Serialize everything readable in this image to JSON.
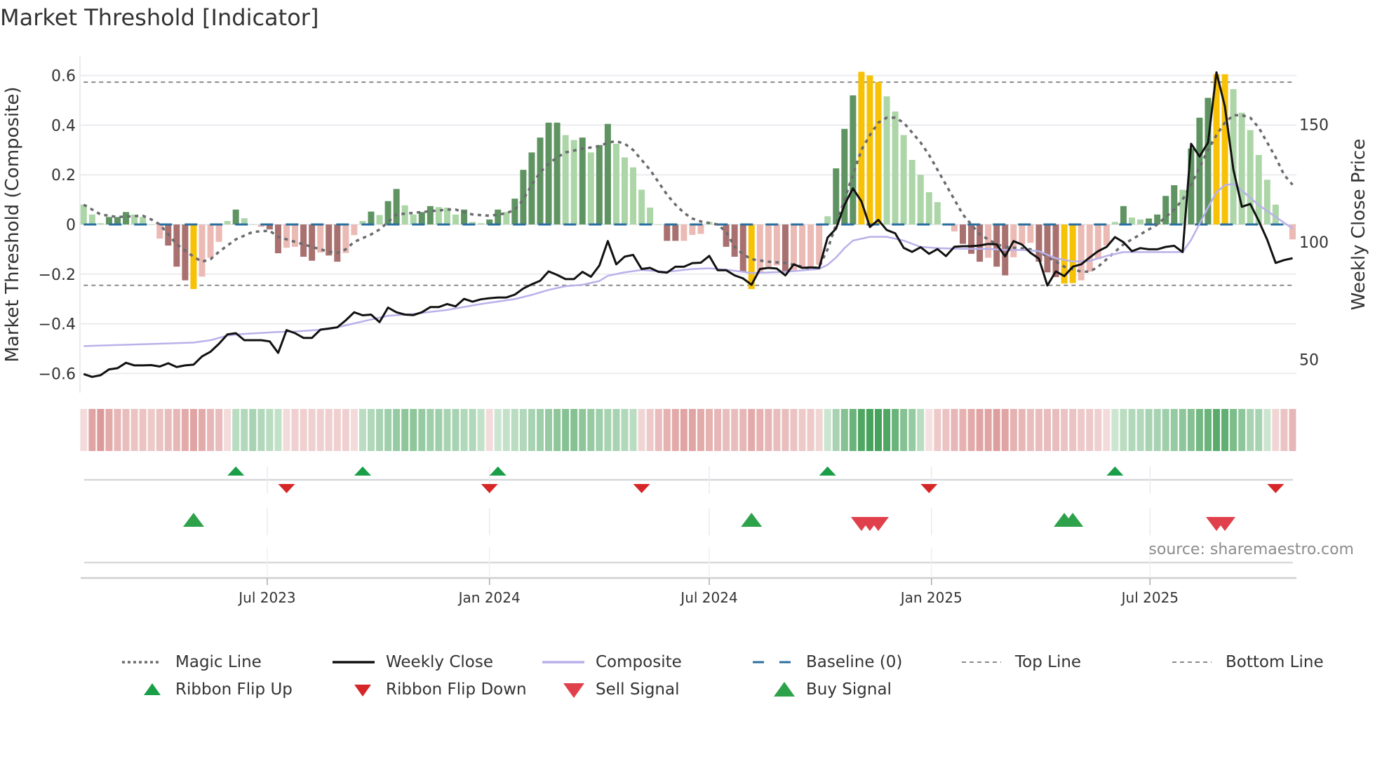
{
  "title": "Market Threshold [Indicator]",
  "source": "source: sharemaestro.com",
  "legend": [
    {
      "label": "Magic Line",
      "icon": "dotted-line"
    },
    {
      "label": "Weekly Close",
      "icon": "solid-line"
    },
    {
      "label": "Composite",
      "icon": "solid-line"
    },
    {
      "label": "Baseline (0)",
      "icon": "dashed-line"
    },
    {
      "label": "Top Line",
      "icon": "dashed-line"
    },
    {
      "label": "Bottom Line",
      "icon": "dashed-line"
    },
    {
      "label": "Ribbon Flip Up",
      "icon": "triangle-up"
    },
    {
      "label": "Ribbon Flip Down",
      "icon": "triangle-down"
    },
    {
      "label": "Sell Signal",
      "icon": "triangle-down"
    },
    {
      "label": "Buy Signal",
      "icon": "triangle-up"
    }
  ],
  "colors": {
    "dg": "#5f9462",
    "lg": "#acd6a7",
    "dr": "#a8716f",
    "lr": "#ebbab5",
    "y": "#f7c106",
    "magic": "#6b6b70",
    "close": "#111111",
    "composite": "#b9b1ea",
    "baseline": "#2a6f9f",
    "threshold": "#8a8a8a",
    "ribbon_pos": "#2f9646",
    "ribbon_neg": "#cf6f6f",
    "flip_up": "#1a9e48",
    "flip_down": "#d62728",
    "buy": "#2ea24a",
    "sell": "#e0404c"
  },
  "chart_data": {
    "type": "bar+line",
    "title": "Market Threshold [Indicator]",
    "ylabel": "Market Threshold (Composite)",
    "y2label": "Weekly Close Price",
    "start_date": "2023-01-30",
    "interval_days": 7,
    "ylim": [
      -0.68,
      0.68
    ],
    "y_ticks": [
      0.6,
      0.4,
      0.2,
      0,
      -0.2,
      -0.4,
      -0.6
    ],
    "y_tick_labels": [
      "0.6",
      "0.4",
      "0.2",
      "0",
      "−0.2",
      "−0.4",
      "−0.6"
    ],
    "y2_ticks": [
      150,
      100,
      50
    ],
    "y2_tick_labels": [
      "150",
      "100",
      "50"
    ],
    "x_ticks": [
      "2023-07-01",
      "2024-01-01",
      "2024-07-01",
      "2025-01-01",
      "2025-07-01"
    ],
    "x_tick_labels": [
      "Jul 2023",
      "Jan 2024",
      "Jul 2024",
      "Jan 2025",
      "Jul 2025"
    ],
    "top_line": 0.573,
    "bottom_line": -0.245,
    "baseline": 0,
    "histogram": [
      0.08,
      0.04,
      0.005,
      0.03,
      0.03,
      0.05,
      0.04,
      0.03,
      0.0,
      -0.057,
      -0.085,
      -0.17,
      -0.225,
      -0.26,
      -0.21,
      -0.134,
      -0.07,
      0.014,
      0.06,
      0.025,
      0.0,
      -0.01,
      -0.02,
      -0.116,
      -0.094,
      -0.09,
      -0.13,
      -0.146,
      -0.113,
      -0.125,
      -0.15,
      -0.115,
      -0.043,
      0.014,
      0.052,
      0.038,
      0.094,
      0.143,
      0.077,
      0.04,
      0.05,
      0.074,
      0.07,
      0.068,
      0.04,
      0.06,
      0.01,
      0.005,
      0.02,
      0.06,
      0.05,
      0.104,
      0.22,
      0.29,
      0.35,
      0.41,
      0.41,
      0.36,
      0.34,
      0.35,
      0.29,
      0.32,
      0.405,
      0.325,
      0.27,
      0.23,
      0.14,
      0.068,
      0.0,
      -0.066,
      -0.066,
      -0.066,
      -0.042,
      -0.038,
      0.01,
      -0.005,
      -0.09,
      -0.13,
      -0.19,
      -0.26,
      -0.19,
      -0.17,
      -0.165,
      -0.19,
      -0.184,
      -0.177,
      -0.173,
      -0.162,
      0.033,
      0.226,
      0.385,
      0.52,
      0.615,
      0.6,
      0.574,
      0.516,
      0.455,
      0.36,
      0.26,
      0.2,
      0.13,
      0.09,
      0.003,
      -0.028,
      -0.078,
      -0.118,
      -0.15,
      -0.134,
      -0.17,
      -0.205,
      -0.132,
      -0.08,
      -0.074,
      -0.15,
      -0.193,
      -0.212,
      -0.238,
      -0.236,
      -0.225,
      -0.19,
      -0.14,
      -0.085,
      0.01,
      0.074,
      0.028,
      0.02,
      0.024,
      0.04,
      0.115,
      0.158,
      0.14,
      0.306,
      0.43,
      0.51,
      0.605,
      0.605,
      0.545,
      0.45,
      0.38,
      0.28,
      0.18,
      0.08,
      0.0,
      -0.06
    ],
    "histogram_class": [
      "lg",
      "lg",
      "lg",
      "dg",
      "dg",
      "dg",
      "lg",
      "lg",
      "lg",
      "lr",
      "dr",
      "dr",
      "dr",
      "y",
      "lr",
      "lr",
      "lr",
      "lg",
      "dg",
      "lg",
      "lg",
      "lr",
      "dr",
      "dr",
      "lr",
      "lr",
      "dr",
      "dr",
      "lr",
      "dr",
      "dr",
      "lr",
      "lr",
      "lg",
      "dg",
      "lg",
      "dg",
      "dg",
      "lg",
      "lg",
      "dg",
      "dg",
      "lg",
      "lg",
      "lg",
      "dg",
      "lg",
      "lg",
      "dg",
      "dg",
      "lg",
      "dg",
      "dg",
      "dg",
      "dg",
      "dg",
      "dg",
      "lg",
      "lg",
      "dg",
      "lg",
      "dg",
      "dg",
      "lg",
      "lg",
      "lg",
      "lg",
      "lg",
      "lg",
      "dr",
      "dr",
      "lr",
      "lr",
      "lr",
      "lg",
      "lr",
      "dr",
      "dr",
      "dr",
      "y",
      "lr",
      "lr",
      "lr",
      "dr",
      "lr",
      "lr",
      "lr",
      "lr",
      "lg",
      "dg",
      "dg",
      "dg",
      "y",
      "y",
      "y",
      "lg",
      "lg",
      "lg",
      "lg",
      "lg",
      "lg",
      "lg",
      "lg",
      "lr",
      "dr",
      "dr",
      "dr",
      "lr",
      "dr",
      "dr",
      "lr",
      "lr",
      "lr",
      "dr",
      "dr",
      "dr",
      "y",
      "y",
      "lr",
      "lr",
      "lr",
      "lr",
      "lg",
      "dg",
      "lg",
      "lg",
      "dg",
      "dg",
      "dg",
      "dg",
      "lg",
      "dg",
      "dg",
      "dg",
      "y",
      "y",
      "lg",
      "lg",
      "lg",
      "lg",
      "lg",
      "lg",
      "lg",
      "lr"
    ],
    "weekly_close": [
      43.8,
      42.6,
      43.3,
      45.8,
      46.3,
      48.6,
      47.5,
      47.5,
      47.6,
      47.0,
      48.4,
      46.8,
      47.5,
      47.8,
      51.3,
      53.3,
      56.7,
      60.7,
      61.2,
      58.2,
      58.2,
      58.2,
      57.7,
      52.8,
      62.5,
      61.2,
      59.2,
      59.2,
      62.7,
      63.2,
      63.7,
      66.7,
      70.1,
      68.8,
      69.1,
      65.9,
      72.1,
      70.1,
      69.1,
      68.9,
      70.1,
      72.3,
      72.3,
      73.6,
      72.6,
      75.8,
      74.6,
      75.6,
      76.1,
      76.4,
      76.4,
      77.6,
      80.2,
      82.0,
      83.5,
      87.5,
      86.0,
      84.2,
      84.2,
      87.3,
      85.2,
      90.0,
      100.4,
      90.5,
      93.8,
      94.5,
      88.5,
      89.0,
      87.3,
      87.0,
      89.5,
      89.5,
      91.0,
      91.2,
      94.1,
      88.0,
      88.0,
      85.8,
      84.5,
      81.8,
      88.5,
      89.0,
      88.7,
      85.8,
      90.5,
      89.0,
      89.2,
      89.0,
      101.9,
      105.7,
      115.8,
      122.8,
      117.3,
      106.4,
      109.4,
      105.1,
      103.7,
      97.5,
      95.8,
      97.8,
      95.0,
      97.0,
      94.0,
      98.0,
      98.2,
      98.2,
      98.5,
      99.2,
      99.0,
      93.9,
      100.4,
      98.9,
      95.4,
      92.9,
      81.5,
      87.5,
      85.5,
      89.5,
      90.5,
      93.4,
      96.1,
      97.9,
      102.1,
      99.9,
      96.1,
      97.4,
      96.9,
      96.9,
      97.9,
      98.4,
      95.7,
      141.8,
      136.4,
      142.3,
      172.2,
      157.7,
      130.9,
      115.0,
      116.2,
      109.0,
      101.0,
      91.1,
      92.3,
      93.1
    ],
    "magic_line": [
      [
        1,
        0.08
      ],
      [
        3,
        0.04
      ],
      [
        5,
        0.03
      ],
      [
        8,
        0.035
      ],
      [
        9,
        0.02
      ],
      [
        10,
        0.0
      ],
      [
        12,
        -0.08
      ],
      [
        14,
        -0.13
      ],
      [
        15,
        -0.15
      ],
      [
        16,
        -0.14
      ],
      [
        17,
        -0.11
      ],
      [
        19,
        -0.06
      ],
      [
        21,
        -0.03
      ],
      [
        23,
        -0.025
      ],
      [
        24,
        -0.05
      ],
      [
        26,
        -0.07
      ],
      [
        28,
        -0.09
      ],
      [
        30,
        -0.11
      ],
      [
        31,
        -0.115
      ],
      [
        32,
        -0.1
      ],
      [
        33,
        -0.07
      ],
      [
        35,
        -0.04
      ],
      [
        36,
        -0.02
      ],
      [
        37,
        0.01
      ],
      [
        38,
        0.04
      ],
      [
        41,
        0.05
      ],
      [
        44,
        0.06
      ],
      [
        45,
        0.06
      ],
      [
        47,
        0.04
      ],
      [
        49,
        0.035
      ],
      [
        51,
        0.045
      ],
      [
        52,
        0.06
      ],
      [
        53,
        0.1
      ],
      [
        54,
        0.16
      ],
      [
        55,
        0.21
      ],
      [
        56,
        0.245
      ],
      [
        57,
        0.27
      ],
      [
        58,
        0.29
      ],
      [
        60,
        0.305
      ],
      [
        62,
        0.315
      ],
      [
        63,
        0.33
      ],
      [
        64,
        0.335
      ],
      [
        65,
        0.325
      ],
      [
        66,
        0.3
      ],
      [
        67,
        0.26
      ],
      [
        68,
        0.22
      ],
      [
        69,
        0.17
      ],
      [
        70,
        0.12
      ],
      [
        71,
        0.08
      ],
      [
        72,
        0.047
      ],
      [
        73,
        0.024
      ],
      [
        74,
        0.012
      ],
      [
        76,
        0.0
      ],
      [
        77,
        -0.03
      ],
      [
        78,
        -0.09
      ],
      [
        79,
        -0.12
      ],
      [
        80,
        -0.14
      ],
      [
        82,
        -0.15
      ],
      [
        84,
        -0.155
      ],
      [
        86,
        -0.17
      ],
      [
        87,
        -0.18
      ],
      [
        88,
        -0.17
      ],
      [
        89,
        -0.1
      ],
      [
        90,
        0.0
      ],
      [
        91,
        0.1
      ],
      [
        92,
        0.2
      ],
      [
        93,
        0.3
      ],
      [
        94,
        0.36
      ],
      [
        95,
        0.41
      ],
      [
        96,
        0.43
      ],
      [
        97,
        0.43
      ],
      [
        98,
        0.41
      ],
      [
        99,
        0.37
      ],
      [
        100,
        0.33
      ],
      [
        101,
        0.28
      ],
      [
        102,
        0.22
      ],
      [
        103,
        0.16
      ],
      [
        104,
        0.1
      ],
      [
        105,
        0.04
      ],
      [
        106,
        0.0
      ],
      [
        107,
        -0.04
      ],
      [
        108,
        -0.06
      ],
      [
        109,
        -0.08
      ],
      [
        110,
        -0.09
      ],
      [
        113,
        -0.1
      ],
      [
        114,
        -0.11
      ],
      [
        115,
        -0.13
      ],
      [
        116,
        -0.15
      ],
      [
        117,
        -0.17
      ],
      [
        118,
        -0.18
      ],
      [
        119,
        -0.19
      ],
      [
        120,
        -0.19
      ],
      [
        121,
        -0.17
      ],
      [
        122,
        -0.14
      ],
      [
        123,
        -0.11
      ],
      [
        124,
        -0.08
      ],
      [
        125,
        -0.06
      ],
      [
        126,
        -0.04
      ],
      [
        127,
        -0.02
      ],
      [
        128,
        0.0
      ],
      [
        129,
        0.03
      ],
      [
        130,
        0.06
      ],
      [
        131,
        0.1
      ],
      [
        132,
        0.16
      ],
      [
        133,
        0.23
      ],
      [
        134,
        0.3
      ],
      [
        135,
        0.36
      ],
      [
        136,
        0.41
      ],
      [
        137,
        0.44
      ],
      [
        138,
        0.44
      ],
      [
        139,
        0.43
      ],
      [
        140,
        0.39
      ],
      [
        141,
        0.33
      ],
      [
        142,
        0.27
      ],
      [
        143,
        0.2
      ],
      [
        144,
        0.16
      ]
    ],
    "composite": [
      [
        1,
        55.7
      ],
      [
        14,
        57.2
      ],
      [
        16,
        58.2
      ],
      [
        18,
        60.2
      ],
      [
        20,
        60.9
      ],
      [
        24,
        61.7
      ],
      [
        26,
        61.9
      ],
      [
        30,
        62.9
      ],
      [
        32,
        64.5
      ],
      [
        34,
        66.2
      ],
      [
        37,
        68.6
      ],
      [
        40,
        69.4
      ],
      [
        44,
        71.1
      ],
      [
        48,
        73.6
      ],
      [
        52,
        75.7
      ],
      [
        54,
        77.5
      ],
      [
        56,
        79.6
      ],
      [
        58,
        81.2
      ],
      [
        60,
        81.8
      ],
      [
        62,
        83.4
      ],
      [
        63,
        85.6
      ],
      [
        65,
        87.1
      ],
      [
        67,
        88.1
      ],
      [
        70,
        87.3
      ],
      [
        73,
        88.5
      ],
      [
        75,
        88.8
      ],
      [
        77,
        88.2
      ],
      [
        79,
        87.3
      ],
      [
        80,
        86.8
      ],
      [
        84,
        87.3
      ],
      [
        88,
        88.5
      ],
      [
        89,
        90.3
      ],
      [
        90,
        93.4
      ],
      [
        91,
        97.4
      ],
      [
        92,
        100.6
      ],
      [
        94,
        102.2
      ],
      [
        96,
        102.2
      ],
      [
        98,
        100.6
      ],
      [
        100,
        97.9
      ],
      [
        102,
        97.4
      ],
      [
        105,
        97.1
      ],
      [
        108,
        97.1
      ],
      [
        110,
        96.6
      ],
      [
        112,
        96.6
      ],
      [
        114,
        96.1
      ],
      [
        116,
        93.1
      ],
      [
        118,
        91.7
      ],
      [
        120,
        91.9
      ],
      [
        122,
        94.1
      ],
      [
        124,
        95.7
      ],
      [
        128,
        95.7
      ],
      [
        131,
        95.7
      ],
      [
        132,
        100.9
      ],
      [
        133,
        107.8
      ],
      [
        134,
        114.7
      ],
      [
        135,
        121.2
      ],
      [
        136,
        124.2
      ],
      [
        137,
        124.7
      ],
      [
        138,
        121.9
      ],
      [
        140,
        115.7
      ],
      [
        142,
        110.7
      ],
      [
        144,
        105.7
      ]
    ],
    "ribbon": [
      -0.15,
      -0.6,
      -0.7,
      -0.55,
      -0.45,
      -0.4,
      -0.35,
      -0.35,
      -0.3,
      -0.35,
      -0.4,
      -0.45,
      -0.55,
      -0.6,
      -0.55,
      -0.45,
      -0.4,
      -0.15,
      0.25,
      0.3,
      0.35,
      0.3,
      0.25,
      0.2,
      -0.15,
      -0.25,
      -0.25,
      -0.25,
      -0.25,
      -0.25,
      -0.25,
      -0.25,
      -0.15,
      0.25,
      0.3,
      0.35,
      0.4,
      0.45,
      0.5,
      0.5,
      0.45,
      0.4,
      0.4,
      0.35,
      0.35,
      0.3,
      0.3,
      0.2,
      -0.15,
      0.15,
      0.2,
      0.25,
      0.3,
      0.35,
      0.4,
      0.45,
      0.5,
      0.55,
      0.55,
      0.5,
      0.45,
      0.4,
      0.35,
      0.35,
      0.3,
      0.25,
      -0.2,
      -0.3,
      -0.4,
      -0.5,
      -0.55,
      -0.6,
      -0.6,
      -0.55,
      -0.5,
      -0.45,
      -0.4,
      -0.4,
      -0.45,
      -0.55,
      -0.5,
      -0.45,
      -0.4,
      -0.4,
      -0.35,
      -0.3,
      -0.3,
      -0.2,
      0.15,
      0.35,
      0.55,
      0.7,
      0.85,
      0.9,
      0.9,
      0.85,
      0.7,
      0.55,
      0.45,
      0.25,
      -0.1,
      -0.3,
      -0.35,
      -0.45,
      -0.5,
      -0.55,
      -0.6,
      -0.6,
      -0.65,
      -0.6,
      -0.5,
      -0.45,
      -0.4,
      -0.4,
      -0.4,
      -0.4,
      -0.35,
      -0.35,
      -0.3,
      -0.3,
      -0.25,
      -0.15,
      0.15,
      0.25,
      0.3,
      0.3,
      0.35,
      0.35,
      0.4,
      0.45,
      0.5,
      0.55,
      0.65,
      0.7,
      0.8,
      0.75,
      0.6,
      0.5,
      0.35,
      0.35,
      0.15,
      -0.2,
      -0.35,
      -0.45
    ],
    "ribbon_flip_up": [
      19,
      34,
      50,
      89,
      123
    ],
    "ribbon_flip_down": [
      25,
      49,
      67,
      101,
      142
    ],
    "buy_signals": [
      14,
      80,
      117,
      118
    ],
    "sell_signals": [
      93,
      94,
      95,
      135,
      136
    ]
  }
}
